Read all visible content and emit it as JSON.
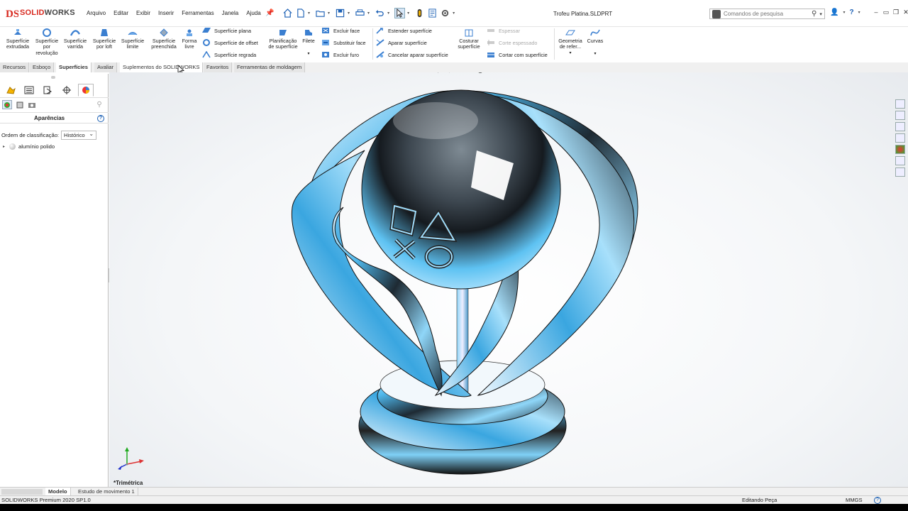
{
  "app": {
    "logo_mark": "DS",
    "logo_part1": "SOLID",
    "logo_part2": "WORKS",
    "document_title": "Trofeu Platina.SLDPRT"
  },
  "menu": [
    "Arquivo",
    "Editar",
    "Exibir",
    "Inserir",
    "Ferramentas",
    "Janela",
    "Ajuda"
  ],
  "search": {
    "placeholder": "Comandos de pesquisa"
  },
  "ribbon": {
    "extruded": "Superfície extrudada",
    "revolved": "Superfície por revolução",
    "swept": "Superfície varrida",
    "loft": "Superfície por loft",
    "boundary": "Superfície limite",
    "filled": "Superfície preenchida",
    "freeform": "Forma livre",
    "planar": "Superfície plana",
    "offset": "Superfície de offset",
    "ruled": "Superfície regrada",
    "flatten": "Planificação de superfície",
    "fillet": "Filete",
    "delete_face": "Excluir face",
    "replace_face": "Substituir face",
    "delete_hole": "Excluir furo",
    "extend": "Estender superfície",
    "trim": "Aparar superfície",
    "untrim": "Cancelar aparar superfície",
    "knit": "Costurar superfície",
    "thicken": "Espessar",
    "thicken_cut": "Corte espessado",
    "cut_with_surface": "Cortar com superfície",
    "ref_geometry": "Geometria de refer...",
    "curves": "Curvas"
  },
  "tabs": [
    {
      "label": "Recursos"
    },
    {
      "label": "Esboço"
    },
    {
      "label": "Superfícies"
    },
    {
      "label": "Avaliar"
    },
    {
      "label": "Suplementos do SOLIDWORKS"
    },
    {
      "label": "Favoritos"
    },
    {
      "label": "Ferramentas de moldagem"
    }
  ],
  "panel": {
    "title": "Aparências",
    "help": "?",
    "sort_label": "Ordem de classificação:",
    "sort_value": "Histórico",
    "tree_item": "alumínio polido"
  },
  "viewport": {
    "view_name": "*Trimétrica"
  },
  "bottom_tabs": [
    {
      "label": "Modelo"
    },
    {
      "label": "Estudo de movimento 1"
    }
  ],
  "status": {
    "product": "SOLIDWORKS Premium 2020 SP1.0",
    "mode": "Editando Peça",
    "units": "MMGS",
    "help": "?"
  },
  "colors": {
    "accent": "#1a5fb4",
    "logo_red": "#d82a20",
    "chrome_blue": "#4fb8ec"
  }
}
